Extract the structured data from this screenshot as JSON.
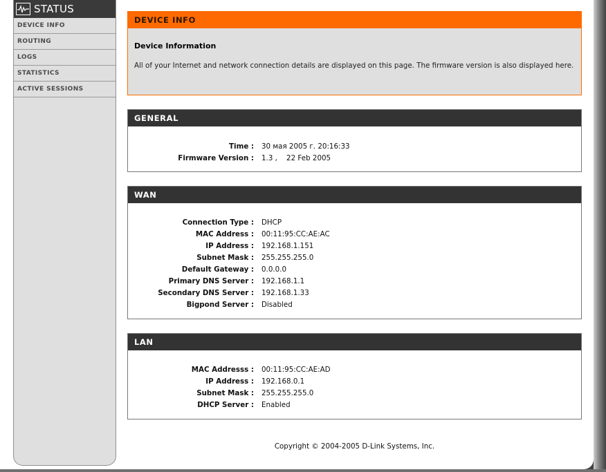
{
  "sidebar": {
    "title": "STATUS",
    "icon": "status-monitor-icon",
    "items": [
      {
        "label": "DEVICE INFO"
      },
      {
        "label": "ROUTING"
      },
      {
        "label": "LOGS"
      },
      {
        "label": "STATISTICS"
      },
      {
        "label": "ACTIVE SESSIONS"
      }
    ]
  },
  "device_info": {
    "header": "DEVICE INFO",
    "title": "Device Information",
    "description": "All of your Internet and network connection details are displayed on this page. The firmware version is also displayed here."
  },
  "general": {
    "header": "GENERAL",
    "rows": [
      {
        "label": "Time :",
        "value": "30 мая 2005 г. 20:16:33"
      },
      {
        "label": "Firmware Version :",
        "value": "1.3 ,    22 Feb 2005"
      }
    ]
  },
  "wan": {
    "header": "WAN",
    "rows": [
      {
        "label": "Connection Type :",
        "value": "DHCP"
      },
      {
        "label": "MAC Address :",
        "value": "00:11:95:CC:AE:AC"
      },
      {
        "label": "IP Address :",
        "value": "192.168.1.151"
      },
      {
        "label": "Subnet Mask :",
        "value": "255.255.255.0"
      },
      {
        "label": "Default Gateway :",
        "value": "0.0.0.0"
      },
      {
        "label": "Primary DNS Server :",
        "value": "192.168.1.1"
      },
      {
        "label": "Secondary DNS Server :",
        "value": "192.168.1.33"
      },
      {
        "label": "Bigpond Server :",
        "value": "Disabled"
      }
    ]
  },
  "lan": {
    "header": "LAN",
    "rows": [
      {
        "label": "MAC Addresss :",
        "value": "00:11:95:CC:AE:AD"
      },
      {
        "label": "IP Address :",
        "value": "192.168.0.1"
      },
      {
        "label": "Subnet Mask :",
        "value": "255.255.255.0"
      },
      {
        "label": "DHCP Server :",
        "value": "Enabled"
      }
    ]
  },
  "footer": {
    "copyright": "Copyright © 2004-2005 D-Link Systems, Inc."
  },
  "colors": {
    "accent": "#ff6a00",
    "header_dark": "#333333",
    "sidebar_bg": "#dfdfdf"
  }
}
